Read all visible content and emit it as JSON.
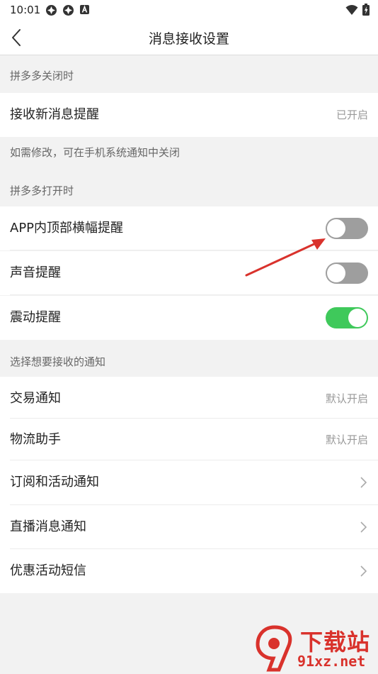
{
  "status_bar": {
    "time": "10:01"
  },
  "header": {
    "title": "消息接收设置"
  },
  "sections": {
    "closed": {
      "label": "拼多多关闭时"
    },
    "open": {
      "label": "拼多多打开时"
    },
    "notify": {
      "label": "选择想要接收的通知"
    }
  },
  "rows": {
    "new_msg": {
      "label": "接收新消息提醒",
      "value": "已开启"
    },
    "banner": {
      "label": "APP内顶部横幅提醒",
      "enabled": false
    },
    "sound": {
      "label": "声音提醒",
      "enabled": false
    },
    "vibrate": {
      "label": "震动提醒",
      "enabled": true
    },
    "trade": {
      "label": "交易通知",
      "value": "默认开启"
    },
    "logistics": {
      "label": "物流助手",
      "value": "默认开启"
    },
    "subscribe": {
      "label": "订阅和活动通知"
    },
    "live": {
      "label": "直播消息通知"
    },
    "sms": {
      "label": "优惠活动短信"
    }
  },
  "note": "如需修改，可在手机系统通知中关闭",
  "watermark": {
    "top": "下载站",
    "bottom": "91xz.net"
  },
  "colors": {
    "toggle_on": "#3fc95b",
    "toggle_off": "#9e9e9e",
    "arrow": "#d9322c"
  }
}
